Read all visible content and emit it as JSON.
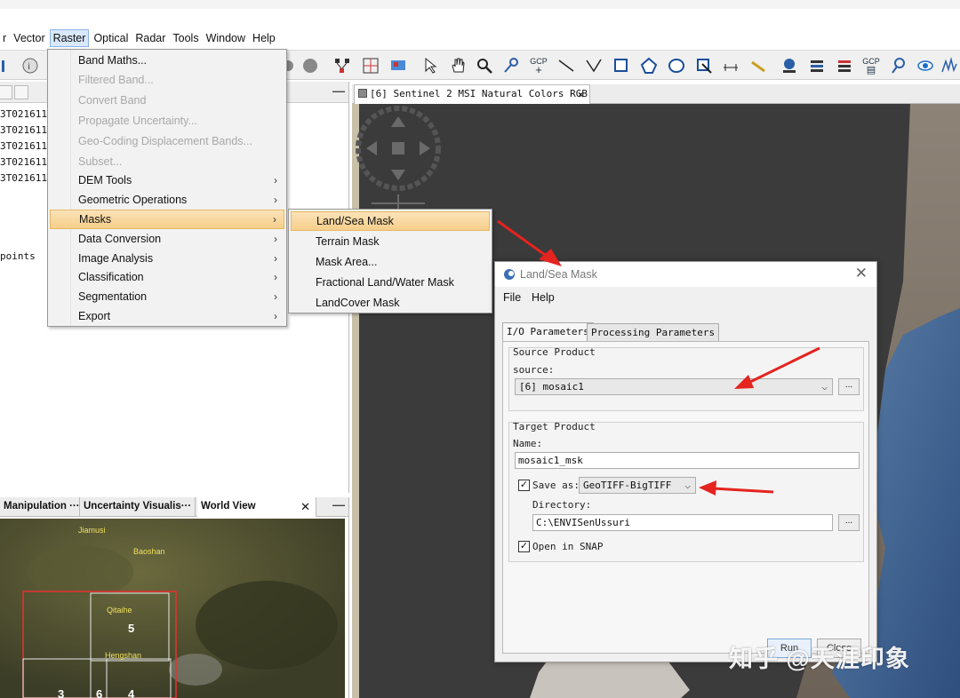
{
  "menubar": {
    "items": [
      "r",
      "Vector",
      "Raster",
      "Optical",
      "Radar",
      "Tools",
      "Window",
      "Help"
    ]
  },
  "toolbar": {
    "gcp_label_1": "GCP",
    "gcp_label_2": "GCP"
  },
  "left_panel": {
    "tree_items": [
      "3T021611_",
      "3T021611_",
      "3T021611_",
      "3T021611_",
      "3T021611_"
    ],
    "points_label": "points"
  },
  "raster_menu": {
    "items": [
      {
        "label": "Band Maths...",
        "enabled": true,
        "submenu": false
      },
      {
        "label": "Filtered Band...",
        "enabled": false,
        "submenu": false
      },
      {
        "label": "Convert Band",
        "enabled": false,
        "submenu": false
      },
      {
        "label": "Propagate Uncertainty...",
        "enabled": false,
        "submenu": false
      },
      {
        "label": "Geo-Coding Displacement Bands...",
        "enabled": false,
        "submenu": false
      },
      {
        "label": "Subset...",
        "enabled": false,
        "submenu": false
      },
      {
        "label": "DEM Tools",
        "enabled": true,
        "submenu": true
      },
      {
        "label": "Geometric Operations",
        "enabled": true,
        "submenu": true
      },
      {
        "label": "Masks",
        "enabled": true,
        "submenu": true,
        "highlighted": true
      },
      {
        "label": "Data Conversion",
        "enabled": true,
        "submenu": true
      },
      {
        "label": "Image Analysis",
        "enabled": true,
        "submenu": true
      },
      {
        "label": "Classification",
        "enabled": true,
        "submenu": true
      },
      {
        "label": "Segmentation",
        "enabled": true,
        "submenu": true
      },
      {
        "label": "Export",
        "enabled": true,
        "submenu": true
      }
    ]
  },
  "masks_submenu": {
    "items": [
      "Land/Sea Mask",
      "Terrain Mask",
      "Mask Area...",
      "Fractional Land/Water Mask",
      "LandCover Mask"
    ]
  },
  "image_view": {
    "tab_label": "[6] Sentinel 2 MSI Natural Colors RGB"
  },
  "bottom_panel": {
    "tabs": [
      "Manipulation ···",
      "Uncertainty Visualis···",
      "World View"
    ],
    "map_labels": [
      "Jiamusi",
      "Baoshan",
      "Qitaihe",
      "Hengshan"
    ],
    "tile_numbers": [
      "5",
      "3",
      "6",
      "4"
    ]
  },
  "dialog": {
    "title": "Land/Sea Mask",
    "menu": [
      "File",
      "Help"
    ],
    "tabs": [
      "I/O Parameters",
      "Processing Parameters"
    ],
    "source_group": "Source Product",
    "source_label": "source:",
    "source_value": "[6] mosaic1",
    "target_group": "Target Product",
    "name_label": "Name:",
    "name_value": "mosaic1_msk",
    "save_as_label": "Save as:",
    "save_as_checked": true,
    "save_format": "GeoTIFF-BigTIFF",
    "directory_label": "Directory:",
    "directory_value": "C:\\ENVISenUssuri",
    "open_in_snap_label": "Open in SNAP",
    "open_in_snap_checked": true,
    "dots": "...",
    "run_label": "Run",
    "close_label": "Close"
  },
  "watermark": "知乎 @天涯印象",
  "colors": {
    "arrow": "#e5231f",
    "menu_highlight": "#f8d89c",
    "map_frame": "#e83030"
  }
}
